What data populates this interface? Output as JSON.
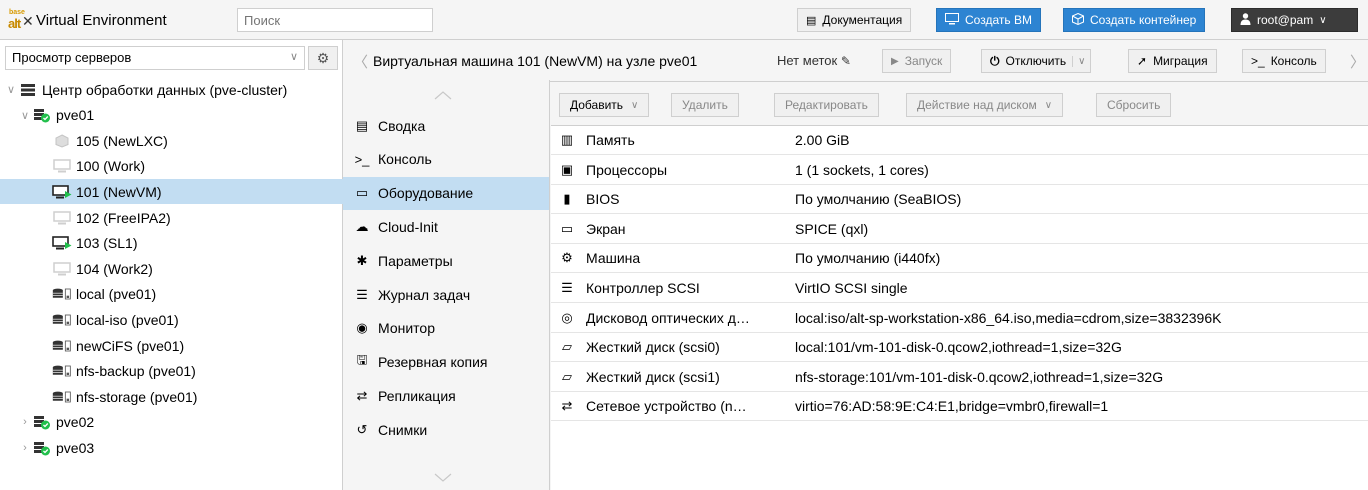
{
  "app": {
    "logo_top": "base",
    "logo_main": "alt",
    "title": "Virtual Environment",
    "search_placeholder": "Поиск"
  },
  "topbar": {
    "docs": "Документация",
    "create_vm": "Создать ВМ",
    "create_ct": "Создать контейнер",
    "user": "root@pam"
  },
  "left": {
    "view": "Просмотр серверов",
    "tree": [
      {
        "label": "Центр обработки данных (pve-cluster)",
        "icon": "datacenter-icon"
      },
      {
        "label": "pve01",
        "icon": "node-online-icon"
      },
      {
        "label": "105 (NewLXC)",
        "icon": "container-icon"
      },
      {
        "label": "100 (Work)",
        "icon": "vm-stopped-icon"
      },
      {
        "label": "101 (NewVM)",
        "icon": "vm-running-icon"
      },
      {
        "label": "102 (FreeIPA2)",
        "icon": "vm-stopped-icon"
      },
      {
        "label": "103 (SL1)",
        "icon": "vm-running-icon"
      },
      {
        "label": "104 (Work2)",
        "icon": "vm-stopped-icon"
      },
      {
        "label": "local (pve01)",
        "icon": "storage-icon"
      },
      {
        "label": "local-iso (pve01)",
        "icon": "storage-icon"
      },
      {
        "label": "newCiFS (pve01)",
        "icon": "storage-icon"
      },
      {
        "label": "nfs-backup (pve01)",
        "icon": "storage-icon"
      },
      {
        "label": "nfs-storage (pve01)",
        "icon": "storage-icon"
      },
      {
        "label": "pve02",
        "icon": "node-online-icon"
      },
      {
        "label": "pve03",
        "icon": "node-online-icon"
      }
    ]
  },
  "header": {
    "title": "Виртуальная машина 101 (NewVM) на узле pve01",
    "tags": "Нет меток",
    "start": "Запуск",
    "shutdown": "Отключить",
    "migrate": "Миграция",
    "console": "Консоль"
  },
  "nav": [
    {
      "label": "Сводка",
      "icon": "summary-icon"
    },
    {
      "label": "Консоль",
      "icon": "console-icon"
    },
    {
      "label": "Оборудование",
      "icon": "hardware-icon"
    },
    {
      "label": "Cloud-Init",
      "icon": "cloud-icon"
    },
    {
      "label": "Параметры",
      "icon": "gear-icon"
    },
    {
      "label": "Журнал задач",
      "icon": "task-log-icon"
    },
    {
      "label": "Монитор",
      "icon": "eye-icon"
    },
    {
      "label": "Резервная копия",
      "icon": "floppy-icon"
    },
    {
      "label": "Репликация",
      "icon": "retweet-icon"
    },
    {
      "label": "Снимки",
      "icon": "history-icon"
    }
  ],
  "toolbar": {
    "add": "Добавить",
    "remove": "Удалить",
    "edit": "Редактировать",
    "disk_action": "Действие над диском",
    "revert": "Сбросить"
  },
  "hardware": [
    {
      "name": "Память",
      "value": "2.00 GiB",
      "icon": "memory-icon"
    },
    {
      "name": "Процессоры",
      "value": "1 (1 sockets, 1 cores)",
      "icon": "cpu-icon"
    },
    {
      "name": "BIOS",
      "value": "По умолчанию (SeaBIOS)",
      "icon": "bios-icon"
    },
    {
      "name": "Экран",
      "value": "SPICE (qxl)",
      "icon": "display-icon"
    },
    {
      "name": "Машина",
      "value": "По умолчанию (i440fx)",
      "icon": "machine-icon"
    },
    {
      "name": "Контроллер SCSI",
      "value": "VirtIO SCSI single",
      "icon": "database-icon"
    },
    {
      "name": "Дисковод оптических д…",
      "value": "local:iso/alt-sp-workstation-x86_64.iso,media=cdrom,size=3832396K",
      "icon": "cdrom-icon"
    },
    {
      "name": "Жесткий диск (scsi0)",
      "value": "local:101/vm-101-disk-0.qcow2,iothread=1,size=32G",
      "icon": "hdd-icon"
    },
    {
      "name": "Жесткий диск (scsi1)",
      "value": "nfs-storage:101/vm-101-disk-0.qcow2,iothread=1,size=32G",
      "icon": "hdd-icon"
    },
    {
      "name": "Сетевое устройство (n…",
      "value": "virtio=76:AD:58:9E:C4:E1,bridge=vmbr0,firewall=1",
      "icon": "network-icon"
    }
  ]
}
